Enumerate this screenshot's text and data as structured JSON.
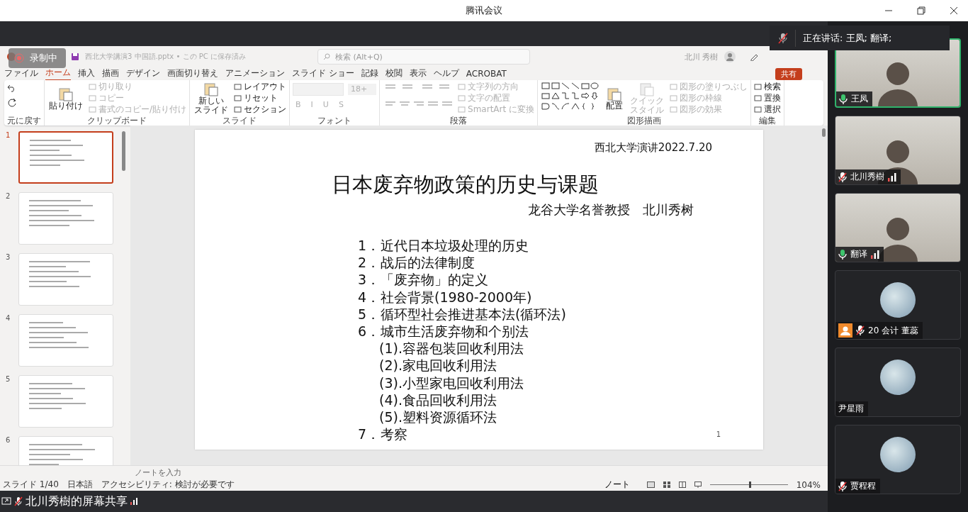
{
  "app_title": "腾讯会议",
  "recording": {
    "label": "录制中"
  },
  "speaking_banner": {
    "text": "正在讲话: 王凤; 翻译;"
  },
  "share_label": "北川秀樹的屏幕共享",
  "ppt": {
    "file_title": "西北大学講演3 中国語.pptx • この PC に保存済み",
    "search": {
      "placeholder": "検索 (Alt+Q)"
    },
    "user": "北川 秀樹",
    "share_button": "共有",
    "tabs": [
      {
        "label": "ファイル",
        "selected": false
      },
      {
        "label": "ホーム",
        "selected": true
      },
      {
        "label": "挿入",
        "selected": false
      },
      {
        "label": "描画",
        "selected": false
      },
      {
        "label": "デザイン",
        "selected": false
      },
      {
        "label": "画面切り替え",
        "selected": false
      },
      {
        "label": "アニメーション",
        "selected": false
      },
      {
        "label": "スライド ショー",
        "selected": false
      },
      {
        "label": "記録",
        "selected": false
      },
      {
        "label": "校閲",
        "selected": false
      },
      {
        "label": "表示",
        "selected": false
      },
      {
        "label": "ヘルプ",
        "selected": false
      },
      {
        "label": "ACROBAT",
        "selected": false
      }
    ],
    "ribbon": [
      {
        "title": "元に戻す",
        "items": [
          {
            "kind": "undo"
          }
        ]
      },
      {
        "title": "クリップボード",
        "items": [
          {
            "kind": "large",
            "lines": [
              "貼り付け"
            ],
            "disabled": false
          },
          {
            "kind": "small",
            "label": "切り取り",
            "disabled": true
          },
          {
            "kind": "small",
            "label": "コピー",
            "disabled": true
          },
          {
            "kind": "small",
            "label": "書式のコピー/貼り付け",
            "disabled": true
          }
        ]
      },
      {
        "title": "スライド",
        "items": [
          {
            "kind": "large",
            "lines": [
              "新しい",
              "スライド"
            ],
            "disabled": false
          },
          {
            "kind": "small",
            "label": "レイアウト",
            "disabled": false
          },
          {
            "kind": "small",
            "label": "リセット",
            "disabled": false
          },
          {
            "kind": "small",
            "label": "セクション",
            "disabled": false
          }
        ]
      },
      {
        "title": "フォント",
        "items": [
          {
            "kind": "font",
            "size": "18+",
            "letters": [
              "B",
              "I",
              "U",
              "S"
            ],
            "disabled": true
          }
        ]
      },
      {
        "title": "段落",
        "items": [
          {
            "kind": "paragraph"
          },
          {
            "kind": "small",
            "label": "文字列の方向",
            "disabled": true
          },
          {
            "kind": "small",
            "label": "文字の配置",
            "disabled": true
          },
          {
            "kind": "small",
            "label": "SmartArt に変換",
            "disabled": true
          }
        ]
      },
      {
        "title": "図形描画",
        "items": [
          {
            "kind": "shapes"
          },
          {
            "kind": "large",
            "lines": [
              "配置"
            ],
            "disabled": false
          },
          {
            "kind": "large",
            "lines": [
              "クイック",
              "スタイル"
            ],
            "disabled": true
          },
          {
            "kind": "small",
            "label": "図形の塗りつぶし",
            "disabled": true
          },
          {
            "kind": "small",
            "label": "図形の枠線",
            "disabled": true
          },
          {
            "kind": "small",
            "label": "図形の効果",
            "disabled": true
          }
        ]
      },
      {
        "title": "編集",
        "items": [
          {
            "kind": "small",
            "label": "検索",
            "disabled": false
          },
          {
            "kind": "small",
            "label": "置換",
            "disabled": false
          },
          {
            "kind": "small",
            "label": "選択",
            "disabled": false
          }
        ]
      }
    ],
    "thumbnails": [
      {
        "number": "1",
        "selected": true
      },
      {
        "number": "2",
        "selected": false
      },
      {
        "number": "3",
        "selected": false
      },
      {
        "number": "4",
        "selected": false
      },
      {
        "number": "5",
        "selected": false
      },
      {
        "number": "6",
        "selected": false
      }
    ],
    "slide": {
      "header": "西北大学演讲2022.7.20",
      "title": "日本废弃物政策的历史与课题",
      "author": "龙谷大学名誉教授　北川秀树",
      "page": "1",
      "items": [
        {
          "number": "1．",
          "text": "近代日本垃圾处理的历史"
        },
        {
          "number": "2．",
          "text": "战后的法律制度"
        },
        {
          "number": "3．",
          "text": "「废弃物」的定义"
        },
        {
          "number": "4．",
          "text": "社会背景(1980-2000年)"
        },
        {
          "number": "5．",
          "text": "循环型社会推进基本法(循环法)"
        },
        {
          "number": "6．",
          "text": "城市生活废弃物和个别法",
          "children": [
            {
              "text": "(1).容器包装回收利用法"
            },
            {
              "text": "(2).家电回收利用法"
            },
            {
              "text": "(3).小型家电回收利用法"
            },
            {
              "text": "(4).食品回收利用法"
            },
            {
              "text": "(5).塑料资源循环法"
            }
          ]
        },
        {
          "number": "7．",
          "text": "考察"
        }
      ]
    },
    "notes_placeholder": "ノートを入力",
    "status": {
      "slide": "スライド 1/40",
      "language": "日本語",
      "accessibility": "アクセシビリティ: 検討が必要です",
      "notes": "ノート",
      "zoom": "104%",
      "level": 0.5
    }
  },
  "participants": [
    {
      "name": "王凤",
      "kind": "video",
      "muted": false,
      "signal": false,
      "guest": false,
      "selected": true
    },
    {
      "name": "北川秀樹",
      "kind": "video",
      "muted": true,
      "signal": true,
      "guest": false,
      "selected": false
    },
    {
      "name": "翻译",
      "kind": "video",
      "muted": false,
      "signal": true,
      "guest": false,
      "selected": false
    },
    {
      "name": "20 会计 董蕊",
      "kind": "avatar",
      "muted": true,
      "signal": false,
      "guest": true,
      "selected": false
    },
    {
      "name": "尹星雨",
      "kind": "avatar",
      "signal": false,
      "guest": false,
      "selected": false
    },
    {
      "name": "贾程程",
      "kind": "avatar",
      "muted": true,
      "signal": false,
      "guest": false,
      "selected": false
    }
  ]
}
